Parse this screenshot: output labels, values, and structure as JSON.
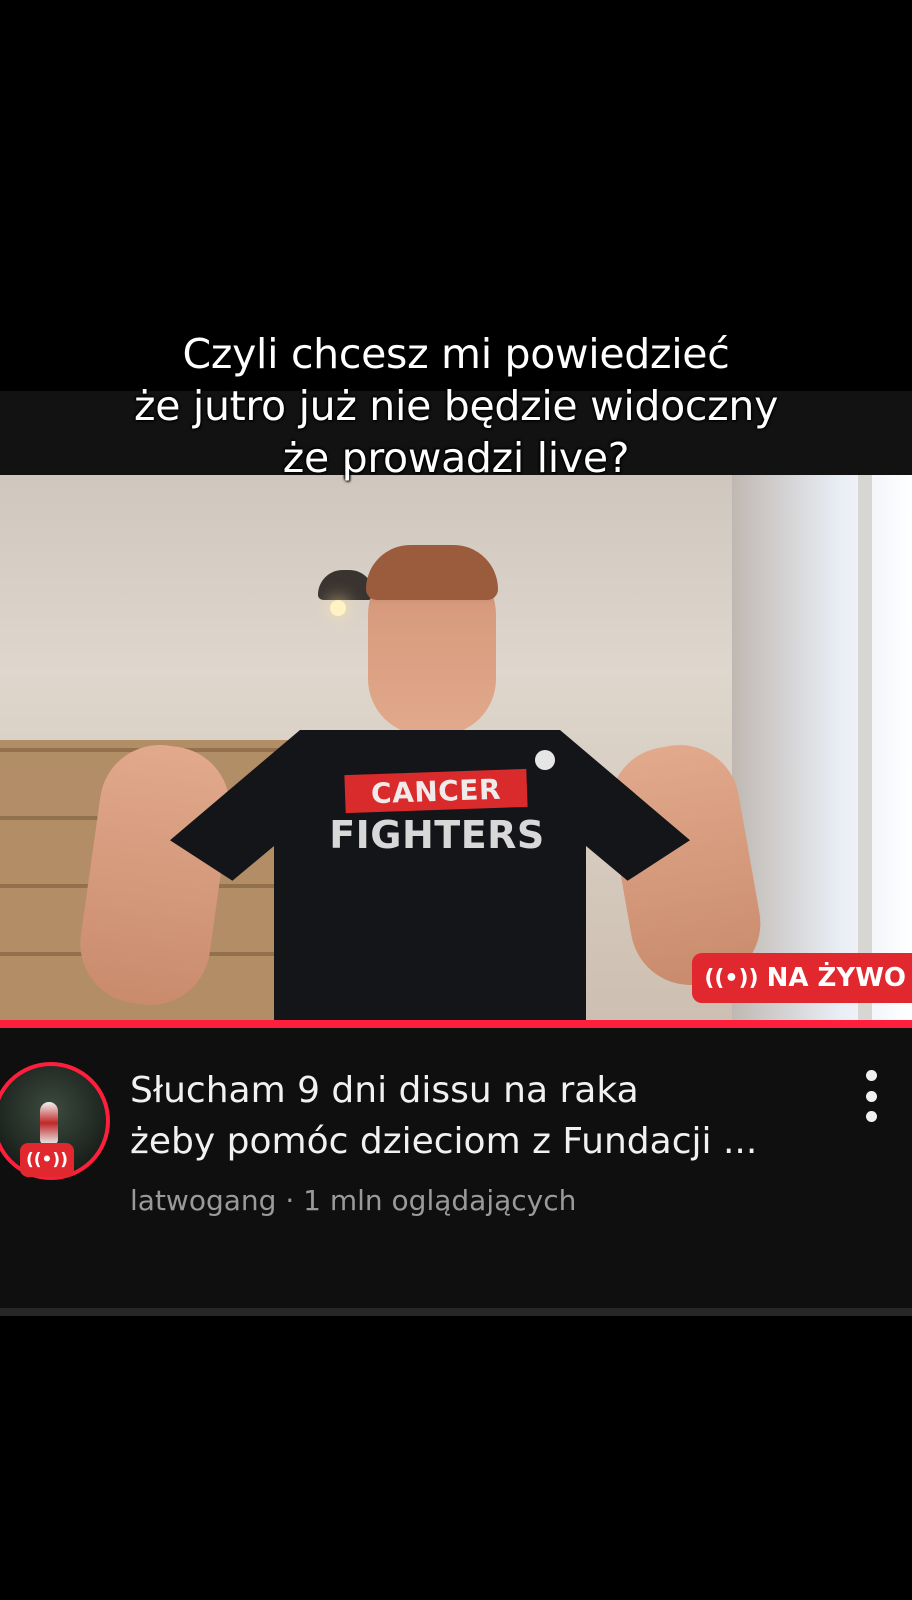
{
  "caption": {
    "line1": "Czyli chcesz mi powiedzieć",
    "line2": "że jutro już nie będzie widoczny",
    "line3": "że prowadzi live?"
  },
  "video": {
    "shirt_badge_text": "CANCER",
    "shirt_main_text": "FIGHTERS",
    "live_badge": {
      "icon": "broadcast-icon",
      "icon_glyph": "((•))",
      "label": "NA ŻYWO"
    },
    "progress_fraction": 1.0
  },
  "info": {
    "title_line1": "Słucham 9 dni dissu na raka",
    "title_line2": "żeby pomóc dzieciom z Fundacji ...",
    "channel": "latwogang",
    "separator": "·",
    "viewers": "1 mln oglądających",
    "avatar_live_icon": "broadcast-icon",
    "avatar_live_glyph": "((•))",
    "menu_icon": "more-vertical-icon"
  },
  "colors": {
    "background": "#000000",
    "panel": "#0f0f0f",
    "live_red": "#e0282e",
    "progress_red": "#ff1f3d",
    "meta_gray": "#9a9a9a",
    "title_white": "#f1f1f1"
  }
}
